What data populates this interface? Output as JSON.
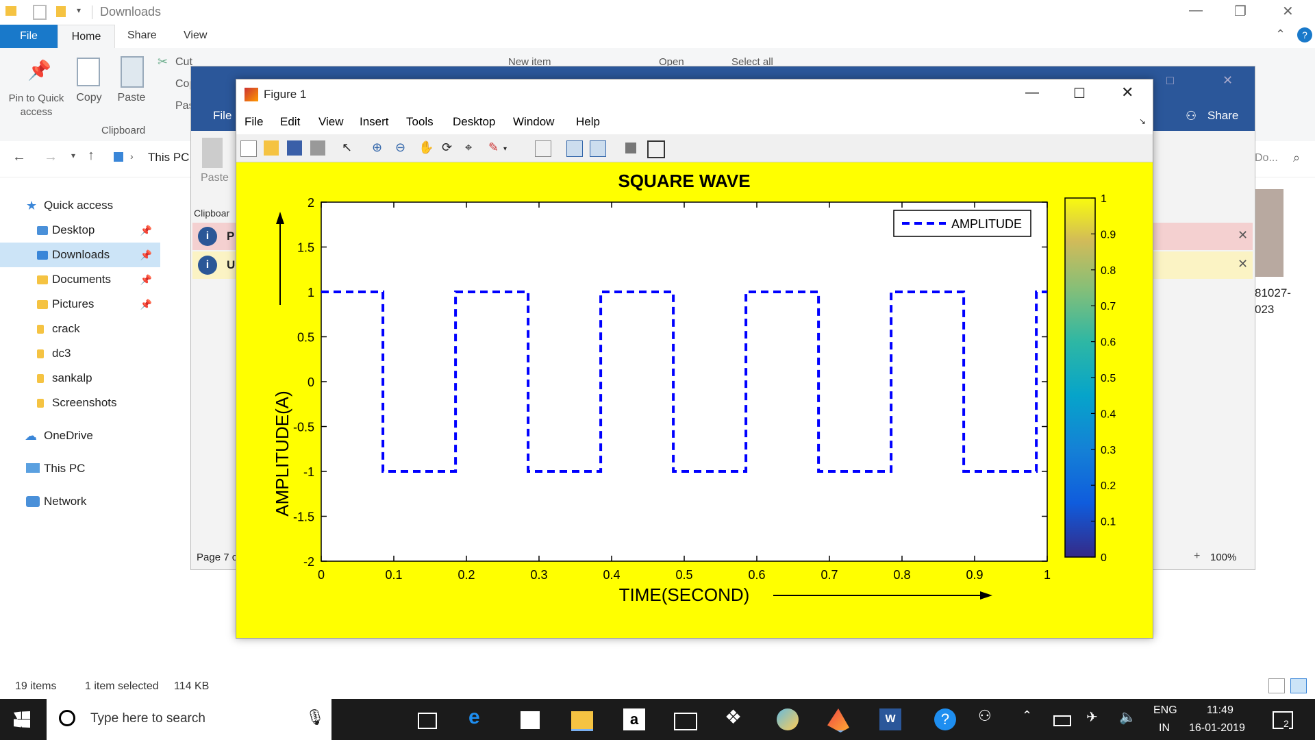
{
  "explorer": {
    "title": "Downloads",
    "tabs": [
      "File",
      "Home",
      "Share",
      "View"
    ],
    "ribbon": {
      "pin_label": "Pin to Quick access",
      "pin_line1": "Pin to Quick",
      "pin_line2": "access",
      "copy_label": "Copy",
      "paste_label": "Paste",
      "cut_label": "Cut",
      "copy_path_label": "Cop",
      "paste_shortcut_label": "Pas",
      "new_item_label": "New item",
      "open_label": "Open",
      "select_all_label": "Select all",
      "group_clipboard": "Clipboard"
    },
    "address": {
      "path": "This PC",
      "search_placeholder": "Do..."
    },
    "nav": {
      "quick_access": "Quick access",
      "items": [
        {
          "label": "Desktop",
          "pinned": true
        },
        {
          "label": "Downloads",
          "pinned": true,
          "selected": true
        },
        {
          "label": "Documents",
          "pinned": true
        },
        {
          "label": "Pictures",
          "pinned": true
        },
        {
          "label": "crack",
          "pinned": false
        },
        {
          "label": "dc3",
          "pinned": false
        },
        {
          "label": "sankalp",
          "pinned": false
        },
        {
          "label": "Screenshots",
          "pinned": false
        }
      ],
      "onedrive": "OneDrive",
      "this_pc": "This PC",
      "network": "Network"
    },
    "status": {
      "count": "19 items",
      "selection": "1 item selected",
      "size": "114 KB"
    },
    "file_fragment_1": "81027-",
    "file_fragment_2": "023"
  },
  "word": {
    "file_tab": "File",
    "share_label": "Share",
    "paste_label": "Paste",
    "clipboard_label": "Clipboar",
    "info_1": "P",
    "info_2": "U",
    "page_label": "Page 7 c",
    "zoom": "100%"
  },
  "figure": {
    "title": "Figure 1",
    "menu": [
      "File",
      "Edit",
      "View",
      "Insert",
      "Tools",
      "Desktop",
      "Window",
      "Help"
    ]
  },
  "chart_data": {
    "type": "line",
    "title": "SQUARE WAVE",
    "xlabel": "TIME(SECOND)",
    "ylabel": "AMPLITUDE(A)",
    "xlim": [
      0,
      1
    ],
    "ylim": [
      -2,
      2
    ],
    "xticks": [
      "0",
      "0.1",
      "0.2",
      "0.3",
      "0.4",
      "0.5",
      "0.6",
      "0.7",
      "0.8",
      "0.9",
      "1"
    ],
    "yticks": [
      "-2",
      "-1.5",
      "-1",
      "-0.5",
      "0",
      "0.5",
      "1",
      "1.5",
      "2"
    ],
    "series": [
      {
        "name": "AMPLITUDE",
        "color": "#0000ff",
        "style": "dashed",
        "x": [
          0,
          0.085,
          0.085,
          0.185,
          0.185,
          0.285,
          0.285,
          0.385,
          0.385,
          0.485,
          0.485,
          0.585,
          0.585,
          0.685,
          0.685,
          0.785,
          0.785,
          0.885,
          0.885,
          0.985,
          0.985,
          1.0
        ],
        "y": [
          1,
          1,
          -1,
          -1,
          1,
          1,
          -1,
          -1,
          1,
          1,
          -1,
          -1,
          1,
          1,
          -1,
          -1,
          1,
          1,
          -1,
          -1,
          1,
          1
        ]
      }
    ],
    "legend": "top-right",
    "colorbar": {
      "ticks": [
        "0",
        "0.1",
        "0.2",
        "0.3",
        "0.4",
        "0.5",
        "0.6",
        "0.7",
        "0.8",
        "0.9",
        "1"
      ],
      "colormap": "parula"
    },
    "background": "#ffff00"
  },
  "taskbar": {
    "search_placeholder": "Type here to search",
    "lang_1": "ENG",
    "lang_2": "IN",
    "time": "11:49",
    "date": "16-01-2019",
    "notifications": "2"
  }
}
